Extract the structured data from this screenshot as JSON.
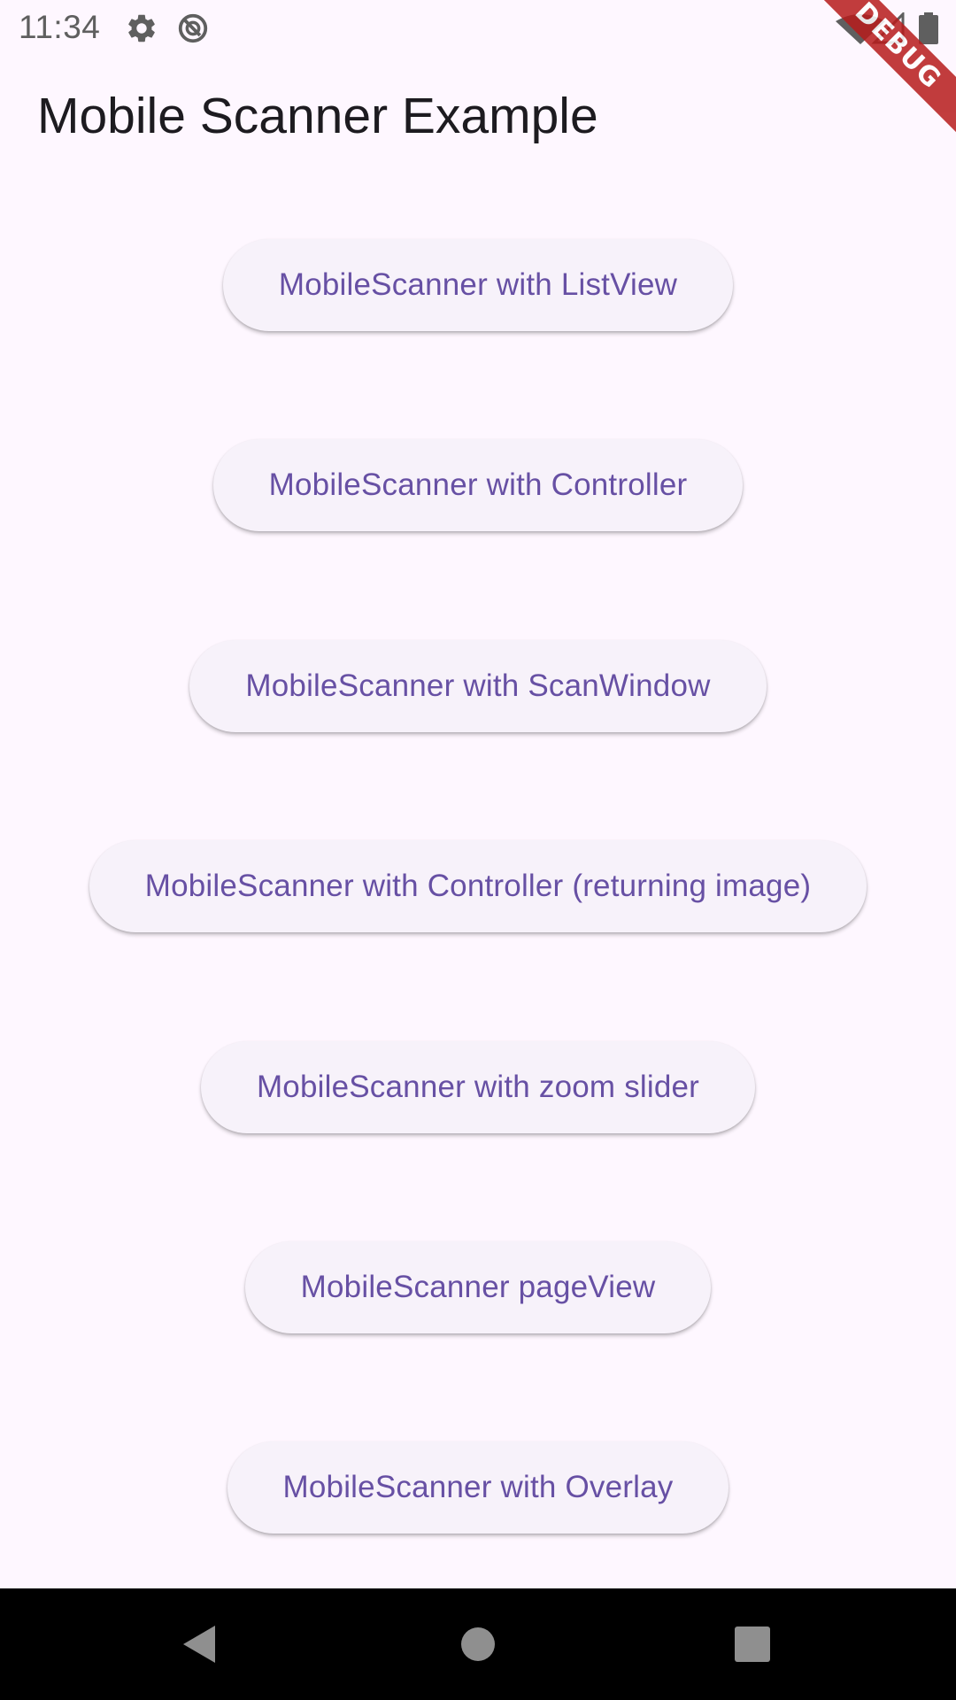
{
  "status_bar": {
    "time": "11:34",
    "icons": [
      "settings-icon",
      "data-saver-icon",
      "wifi-icon",
      "cellular-signal-icon",
      "battery-icon"
    ]
  },
  "app_bar": {
    "title": "Mobile Scanner Example"
  },
  "debug_banner": {
    "label": "DEBUG",
    "color": "#b71c1c"
  },
  "buttons": [
    {
      "label": "MobileScanner with ListView"
    },
    {
      "label": "MobileScanner with Controller"
    },
    {
      "label": "MobileScanner with ScanWindow"
    },
    {
      "label": "MobileScanner with Controller (returning image)"
    },
    {
      "label": "MobileScanner with zoom slider"
    },
    {
      "label": "MobileScanner pageView"
    },
    {
      "label": "MobileScanner with Overlay"
    }
  ],
  "navigation_bar": {
    "icons": [
      "back-icon",
      "home-icon",
      "recents-icon"
    ]
  },
  "colors": {
    "background": "#fef7ff",
    "button_background": "#f7f2fa",
    "button_text": "#6750a4",
    "title_text": "#1d1b20",
    "nav_bar": "#000000"
  }
}
